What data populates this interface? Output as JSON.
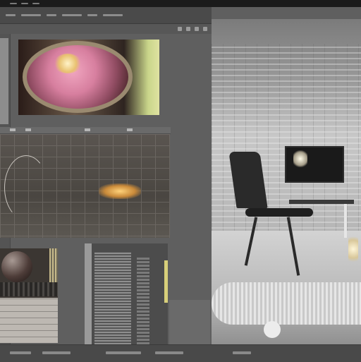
{
  "window": {
    "title": ""
  },
  "viewport": {
    "label": ""
  },
  "panels": [
    {
      "name": "preview-pink-material"
    },
    {
      "name": "preview-grid-scene"
    },
    {
      "name": "preview-sphere"
    },
    {
      "name": "preview-lines"
    },
    {
      "name": "render-view"
    }
  ],
  "colors": {
    "chrome_dark": "#1b1b1b",
    "panel_bg": "#5f5f5f",
    "accent_yellow": "#d8cf7a",
    "pink_material": "#d77f9f"
  },
  "icons": [
    "menu-icon",
    "toolbar-icon",
    "status-icon"
  ]
}
